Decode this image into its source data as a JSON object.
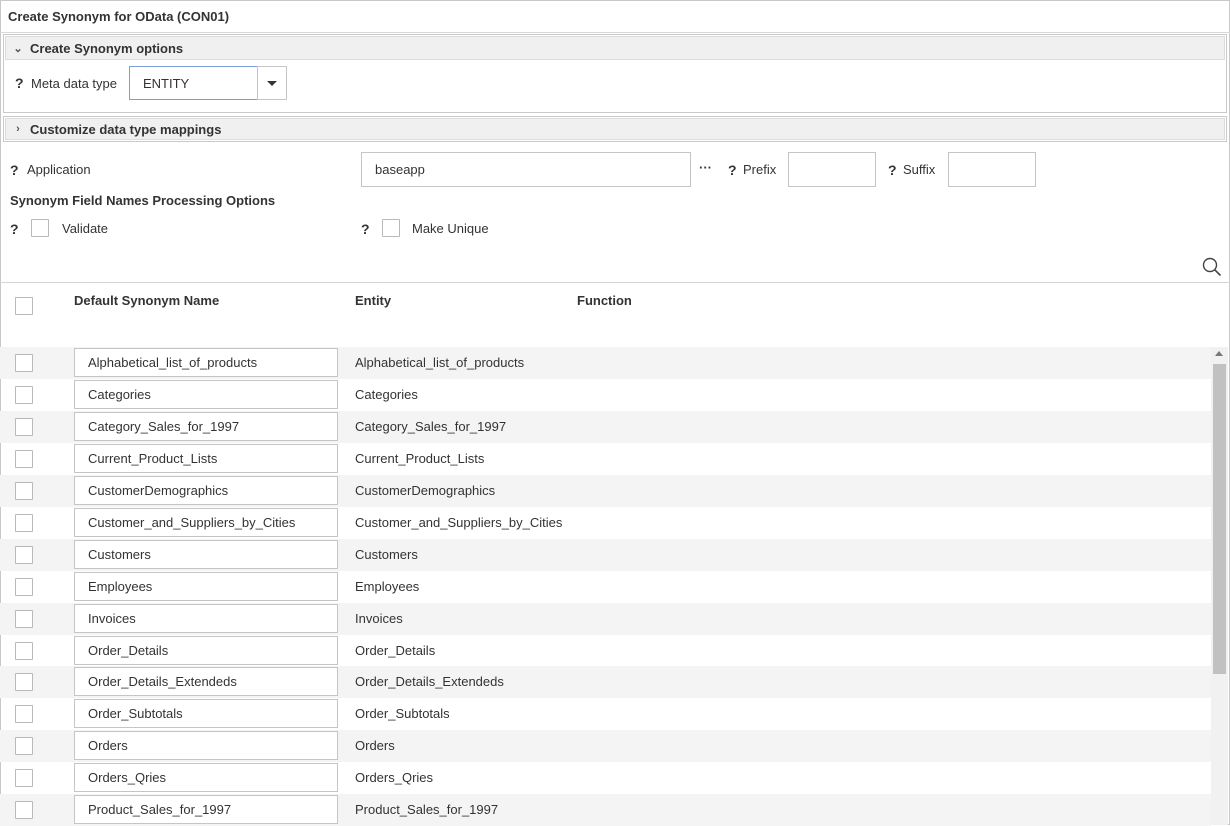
{
  "window": {
    "title": "Create Synonym for OData (CON01)"
  },
  "options_section": {
    "title": "Create Synonym options",
    "meta_data_type_label": "Meta data type",
    "meta_data_type_value": "ENTITY",
    "help": "?"
  },
  "mappings_section": {
    "title": "Customize data type mappings"
  },
  "form": {
    "application_label": "Application",
    "application_value": "baseapp",
    "browse_label": "···",
    "prefix_label": "Prefix",
    "prefix_value": "",
    "suffix_label": "Suffix",
    "suffix_value": "",
    "processing_heading": "Synonym Field Names Processing Options",
    "validate_label": "Validate",
    "make_unique_label": "Make Unique",
    "help": "?"
  },
  "table": {
    "columns": [
      "Default Synonym Name",
      "Entity",
      "Function"
    ],
    "rows": [
      {
        "name": "Alphabetical_list_of_products",
        "entity": "Alphabetical_list_of_products"
      },
      {
        "name": "Categories",
        "entity": "Categories"
      },
      {
        "name": "Category_Sales_for_1997",
        "entity": "Category_Sales_for_1997"
      },
      {
        "name": "Current_Product_Lists",
        "entity": "Current_Product_Lists"
      },
      {
        "name": "CustomerDemographics",
        "entity": "CustomerDemographics"
      },
      {
        "name": "Customer_and_Suppliers_by_Cities",
        "entity": "Customer_and_Suppliers_by_Cities"
      },
      {
        "name": "Customers",
        "entity": "Customers"
      },
      {
        "name": "Employees",
        "entity": "Employees"
      },
      {
        "name": "Invoices",
        "entity": "Invoices"
      },
      {
        "name": "Order_Details",
        "entity": "Order_Details"
      },
      {
        "name": "Order_Details_Extendeds",
        "entity": "Order_Details_Extendeds"
      },
      {
        "name": "Order_Subtotals",
        "entity": "Order_Subtotals"
      },
      {
        "name": "Orders",
        "entity": "Orders"
      },
      {
        "name": "Orders_Qries",
        "entity": "Orders_Qries"
      },
      {
        "name": "Product_Sales_for_1997",
        "entity": "Product_Sales_for_1997"
      }
    ]
  },
  "icons": {
    "search": "search-icon",
    "expand": "chevron-down-icon",
    "collapse": "chevron-right-icon"
  },
  "colors": {
    "focus_border": "#7e9ed8",
    "row_alt": "#f4f4f4",
    "header_bg": "#f0f0f0"
  }
}
